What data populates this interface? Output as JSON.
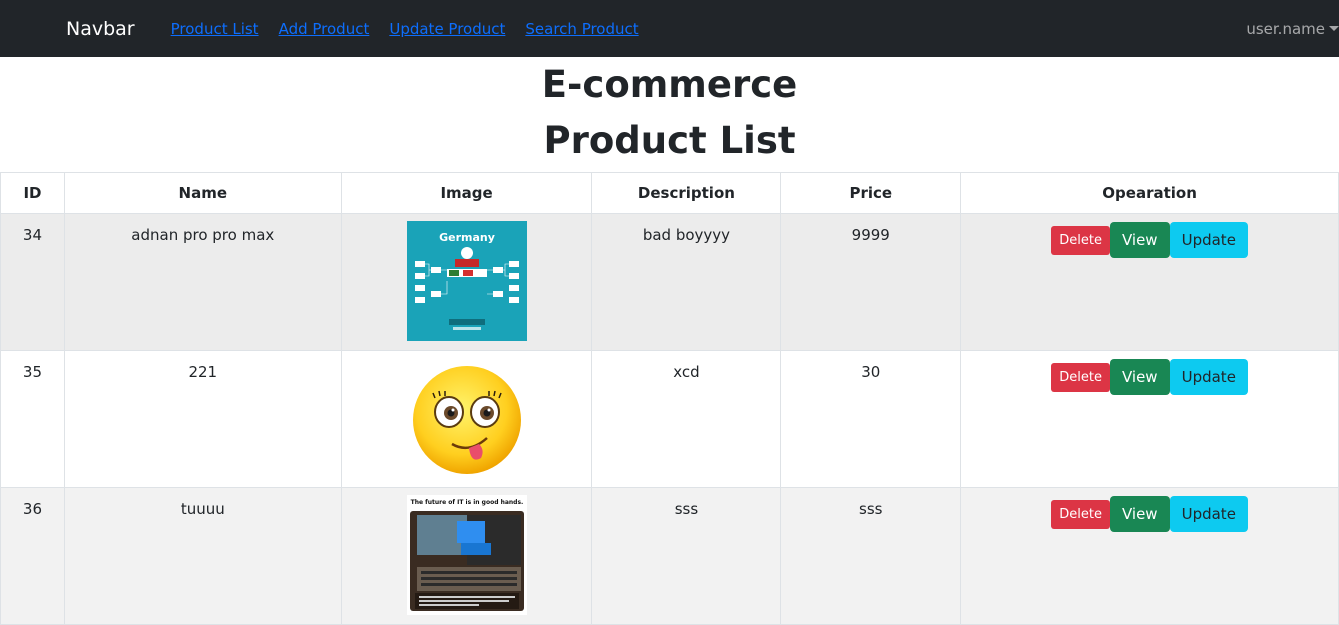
{
  "navbar": {
    "brand": "Navbar",
    "links": [
      "Product List",
      "Add Product",
      "Update Product",
      "Search Product"
    ],
    "user": "user.name"
  },
  "headings": {
    "line1": "E-commerce",
    "line2": "Product List"
  },
  "table": {
    "headers": [
      "ID",
      "Name",
      "Image",
      "Description",
      "Price",
      "Opearation"
    ],
    "rows": [
      {
        "id": "34",
        "name": "adnan pro pro max",
        "description": "bad boyyyy",
        "price": "9999",
        "image": "Germany"
      },
      {
        "id": "35",
        "name": "221",
        "description": "xcd",
        "price": "30",
        "image": "emoji"
      },
      {
        "id": "36",
        "name": "tuuuu",
        "description": "sss",
        "price": "sss",
        "image": "The future of IT is in good hands."
      }
    ],
    "ops": {
      "delete": "Delete",
      "view": "View",
      "update": "Update"
    }
  },
  "colors": {
    "navbar": "#212529",
    "link": "#0d6efd",
    "danger": "#dc3545",
    "success": "#198754",
    "info": "#0dcaf0"
  }
}
